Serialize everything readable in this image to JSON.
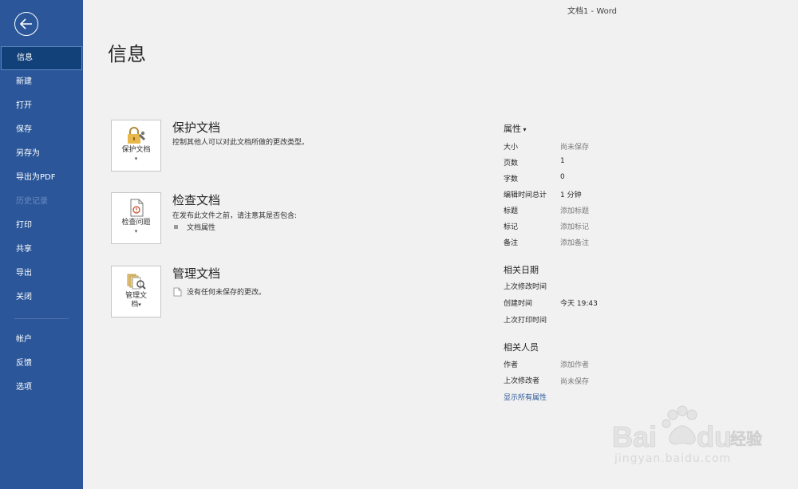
{
  "window": {
    "title": "文档1  -  Word"
  },
  "page": {
    "title": "信息"
  },
  "sidebar": {
    "items": [
      {
        "label": "信息"
      },
      {
        "label": "新建"
      },
      {
        "label": "打开"
      },
      {
        "label": "保存"
      },
      {
        "label": "另存为"
      },
      {
        "label": "导出为PDF"
      },
      {
        "label": "历史记录"
      },
      {
        "label": "打印"
      },
      {
        "label": "共享"
      },
      {
        "label": "导出"
      },
      {
        "label": "关闭"
      },
      {
        "label": "帐户"
      },
      {
        "label": "反馈"
      },
      {
        "label": "选项"
      }
    ]
  },
  "protect": {
    "button_label": "保护文档",
    "title": "保护文档",
    "desc": "控制其他人可以对此文档所做的更改类型。"
  },
  "inspect": {
    "button_label": "检查问题",
    "title": "检查文档",
    "desc": "在发布此文件之前，请注意其是否包含:",
    "bullet": "文档属性"
  },
  "manage": {
    "button_label_1": "管理文",
    "button_label_2": "档",
    "title": "管理文档",
    "desc": "没有任何未保存的更改。"
  },
  "properties": {
    "title": "属性",
    "rows": [
      {
        "label": "大小",
        "value": "尚未保存"
      },
      {
        "label": "页数",
        "value": "1"
      },
      {
        "label": "字数",
        "value": "0"
      },
      {
        "label": "编辑时间总计",
        "value": "1 分钟"
      },
      {
        "label": "标题",
        "value": "添加标题"
      },
      {
        "label": "标记",
        "value": "添加标记"
      },
      {
        "label": "备注",
        "value": "添加备注"
      }
    ],
    "dates_title": "相关日期",
    "dates": [
      {
        "label": "上次修改时间",
        "value": ""
      },
      {
        "label": "创建时间",
        "value": "今天 19:43"
      },
      {
        "label": "上次打印时间",
        "value": ""
      }
    ],
    "people_title": "相关人员",
    "people": [
      {
        "label": "作者",
        "value": "添加作者"
      },
      {
        "label": "上次修改者",
        "value": "尚未保存"
      }
    ],
    "show_all": "显示所有属性"
  },
  "watermark": {
    "text": "jingyan.baidu.com"
  },
  "colors": {
    "sidebar": "#2b579a",
    "link": "#2b579a",
    "background": "#f1f1f1"
  }
}
